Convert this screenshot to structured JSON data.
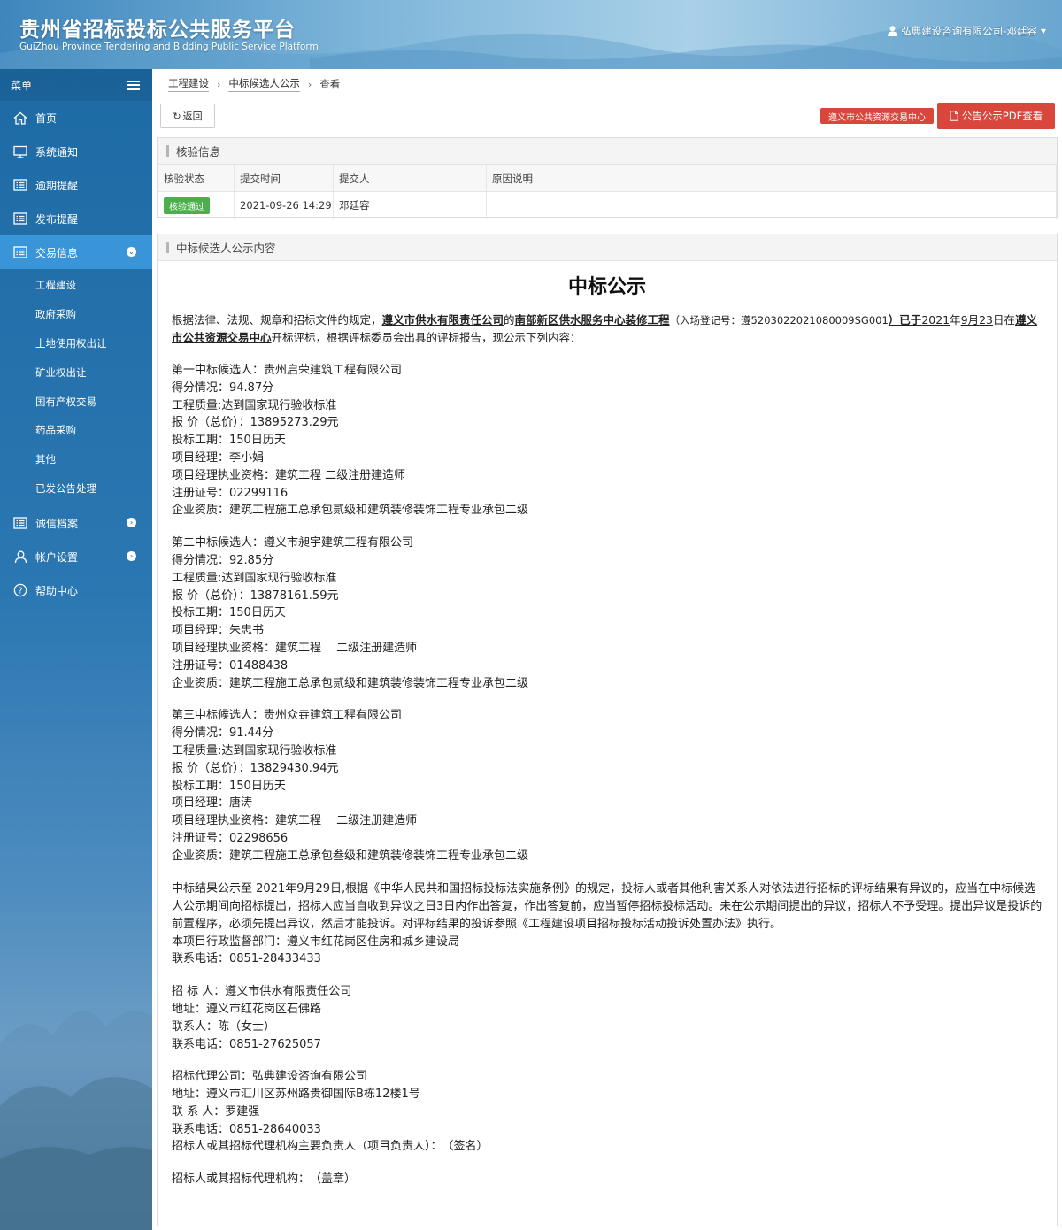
{
  "header": {
    "title": "贵州省招标投标公共服务平台",
    "subtitle": "GuiZhou Province Tendering and Bidding Public Service Platform",
    "user": "弘典建设咨询有限公司-邓廷容"
  },
  "sidebar": {
    "menu_label": "菜单",
    "items": [
      {
        "label": "首页",
        "icon": "home-icon"
      },
      {
        "label": "系统通知",
        "icon": "monitor-icon"
      },
      {
        "label": "逾期提醒",
        "icon": "list-icon"
      },
      {
        "label": "发布提醒",
        "icon": "list-icon"
      },
      {
        "label": "交易信息",
        "icon": "list-icon"
      }
    ],
    "sub_items": [
      "工程建设",
      "政府采购",
      "土地使用权出让",
      "矿业权出让",
      "国有产权交易",
      "药品采购",
      "其他",
      "已发公告处理"
    ],
    "bottom_items": [
      {
        "label": "诚信档案",
        "icon": "list-icon"
      },
      {
        "label": "帐户设置",
        "icon": "user-icon"
      },
      {
        "label": "帮助中心",
        "icon": "help-icon"
      }
    ]
  },
  "breadcrumb": [
    "工程建设",
    "中标候选人公示",
    "查看"
  ],
  "toolbar": {
    "back_label": "返回",
    "center_tag": "遵义市公共资源交易中心",
    "pdf_label": "公告公示PDF查看"
  },
  "check_panel": {
    "title": "核验信息",
    "columns": [
      "核验状态",
      "提交时间",
      "提交人",
      "原因说明"
    ],
    "row": {
      "status": "核验通过",
      "time": "2021-09-26 14:29",
      "submitter": "邓廷容",
      "reason": ""
    }
  },
  "content_panel": {
    "title": "中标候选人公示内容",
    "doc_title": "中标公示",
    "intro": {
      "p1": "根据法律、法规、规章和招标文件的规定，",
      "owner": "遵义市供水有限责任公司",
      "p2": "的",
      "project": "南部新区供水服务中心装修工程",
      "p3": "（入场登记号：遵520302202108000​9SG001",
      "p4": "）已于",
      "year": "2021",
      "p5": "年",
      "month": "9月",
      "day": "23",
      "p6": "日在",
      "venue": "遵义市公共资源交易中心",
      "p7": "开标评标，根据评标委员会出具的评标报告，现公示下列内容："
    },
    "candidates": [
      [
        "第一中标候选人：贵州启荣建筑工程有限公司",
        "得分情况：94.87分",
        "工程质量:达到国家现行验收标准",
        "报 价（总价）：13895273.29元",
        "投标工期：150日历天",
        "项目经理：李小娟",
        "项目经理执业资格：建筑工程 二级注册建造师",
        "注册证号：02299116",
        "企业资质：建筑工程施工总承包贰级和建筑装修装饰工程专业承包二级"
      ],
      [
        "第二中标候选人：遵义市昶宇建筑工程有限公司",
        "得分情况：92.85分",
        "工程质量:达到国家现行验收标准",
        "报 价（总价）：13878161.59元",
        "投标工期：150日历天",
        "项目经理：朱忠书",
        "项目经理执业资格：建筑工程　 二级注册建造师",
        "注册证号：01488438",
        "企业资质：建筑工程施工总承包贰级和建筑装修装饰工程专业承包二级"
      ],
      [
        "第三中标候选人：贵州众垚建筑工程有限公司",
        "得分情况：91.44分",
        "工程质量:达到国家现行验收标准",
        "报 价（总价）：13829430.94元",
        "投标工期：150日历天",
        "项目经理：唐涛",
        "项目经理执业资格：建筑工程　 二级注册建造师",
        "注册证号：02298656",
        "企业资质：建筑工程施工总承包叁级和建筑装修装饰工程专业承包二级"
      ]
    ],
    "notice": "中标结果公示至 2021年9月29日,根据《中华人民共和国招标投标法实施条例》的规定，投标人或者其他利害关系人对依法进行招标的评标结果有异议的，应当在中标候选人公示期间向招标提出，招标人应当自收到异议之日3日内作出答复，作出答复前，应当暂停招标投标活动。未在公示期间提出的异议，招标人不予受理。提出异议是投诉的前置程序，必须先提出异议，然后才能投诉。对评标结果的投诉参照《工程建设项目招标投标活动投诉处置办法》执行。",
    "supervisor": "本项目行政监督部门：遵义市红花岗区住房和城乡建设局",
    "supervisor_phone": "联系电话：0851-28433433",
    "tenderer": [
      "招 标 人：遵义市供水有限责任公司",
      "地址：遵义市红花岗区石佛路",
      "联系人：陈（女士）",
      "联系电话：0851-27625057"
    ],
    "agency": [
      "招标代理公司：弘典建设咨询有限公司",
      "地址：遵义市汇川区苏州路贵御国际B栋12楼1号",
      "联 系 人：罗建强",
      "联系电话：0851-28640033",
      "招标人或其招标代理机构主要负责人（项目负责人）：　（签名）"
    ],
    "seal": "招标人或其招标代理机构：　（盖章）"
  },
  "colors": {
    "accent": "#3a95d8",
    "sidebar": "#2b77b2",
    "danger": "#d9473c",
    "success": "#4cae4c"
  }
}
